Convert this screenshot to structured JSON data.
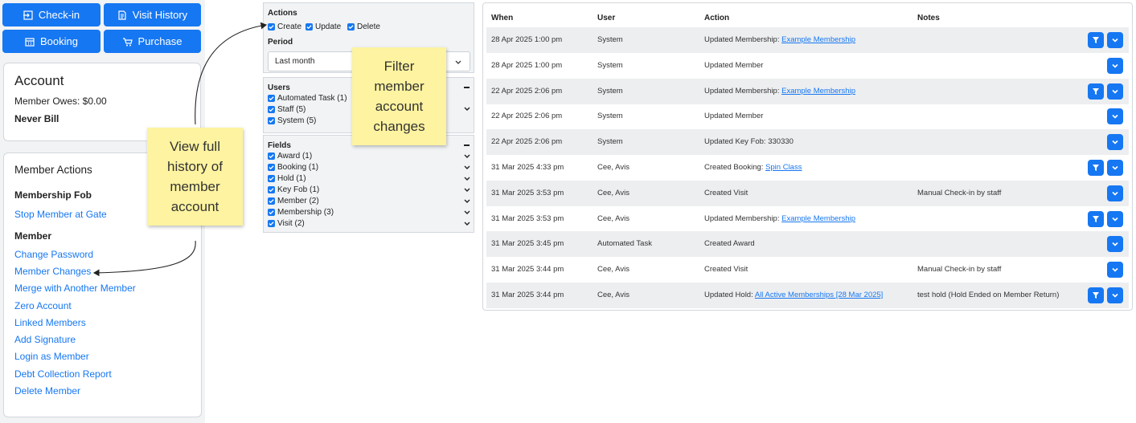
{
  "toolbar": {
    "checkin_label": "Check-in",
    "visit_history_label": "Visit History",
    "booking_label": "Booking",
    "purchase_label": "Purchase"
  },
  "account": {
    "title": "Account",
    "owes": "Member Owes: $0.00",
    "billing": "Never Bill"
  },
  "member_actions": {
    "title": "Member Actions",
    "fob_heading": "Membership Fob",
    "stop_gate": "Stop Member at Gate",
    "member_heading": "Member",
    "links": [
      "Change Password",
      "Member Changes",
      "Merge with Another Member",
      "Zero Account",
      "Linked Members",
      "Add Signature",
      "Login as Member",
      "Debt Collection Report",
      "Delete Member"
    ]
  },
  "filters": {
    "actions_label": "Actions",
    "actions": [
      "Create",
      "Update",
      "Delete"
    ],
    "period_label": "Period",
    "period_value": "Last month",
    "users_label": "Users",
    "users": [
      "Automated Task (1)",
      "Staff (5)",
      "System (5)"
    ],
    "fields_label": "Fields",
    "fields": [
      "Award (1)",
      "Booking (1)",
      "Hold (1)",
      "Key Fob (1)",
      "Member (2)",
      "Membership (3)",
      "Visit (2)"
    ]
  },
  "table": {
    "headers": {
      "when": "When",
      "user": "User",
      "action": "Action",
      "notes": "Notes"
    },
    "rows": [
      {
        "when": "28 Apr 2025 1:00 pm",
        "user": "System",
        "action": "Updated Membership:",
        "link": "Example Membership",
        "notes": ""
      },
      {
        "when": "28 Apr 2025 1:00 pm",
        "user": "System",
        "action": "Updated Member",
        "link": "",
        "notes": ""
      },
      {
        "when": "22 Apr 2025 2:06 pm",
        "user": "System",
        "action": "Updated Membership:",
        "link": "Example Membership",
        "notes": ""
      },
      {
        "when": "22 Apr 2025 2:06 pm",
        "user": "System",
        "action": "Updated Member",
        "link": "",
        "notes": ""
      },
      {
        "when": "22 Apr 2025 2:06 pm",
        "user": "System",
        "action": "Updated Key Fob: 330330",
        "link": "",
        "notes": ""
      },
      {
        "when": "31 Mar 2025 4:33 pm",
        "user": "Cee, Avis",
        "action": "Created Booking:",
        "link": "Spin Class",
        "notes": ""
      },
      {
        "when": "31 Mar 2025 3:53 pm",
        "user": "Cee, Avis",
        "action": "Created Visit",
        "link": "",
        "notes": "Manual Check-in by staff"
      },
      {
        "when": "31 Mar 2025 3:53 pm",
        "user": "Cee, Avis",
        "action": "Updated Membership:",
        "link": "Example Membership",
        "notes": ""
      },
      {
        "when": "31 Mar 2025 3:45 pm",
        "user": "Automated Task",
        "action": "Created Award",
        "link": "",
        "notes": ""
      },
      {
        "when": "31 Mar 2025 3:44 pm",
        "user": "Cee, Avis",
        "action": "Created Visit",
        "link": "",
        "notes": "Manual Check-in by staff"
      },
      {
        "when": "31 Mar 2025 3:44 pm",
        "user": "Cee, Avis",
        "action": "Updated Hold:",
        "link": "All Active Memberships [28 Mar 2025]",
        "notes": "test hold (Hold Ended on Member Return)"
      }
    ]
  },
  "notes": {
    "history": [
      "View full",
      "history of",
      "member",
      "account"
    ],
    "filter": [
      "Filter",
      "member",
      "account",
      "changes"
    ]
  },
  "colors": {
    "accent": "#1677f2",
    "note": "#fdf3a0",
    "row_alt": "#eceef0"
  }
}
